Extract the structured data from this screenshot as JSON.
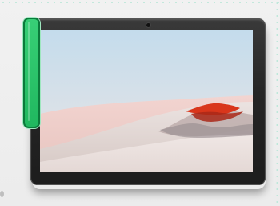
{
  "scene": {
    "object": "tablet",
    "wallpaper": "desert-dunes",
    "highlight_color": "#27c46a",
    "highlight_border": "#0b7a3b",
    "background_color": "#eeeeee",
    "screen_sky_color": "#c9d8e6",
    "dune_color": "#e8d8d4",
    "accent_red": "#d9361b"
  },
  "icons": {
    "camera": "camera-icon",
    "selection": "selection-highlight"
  }
}
